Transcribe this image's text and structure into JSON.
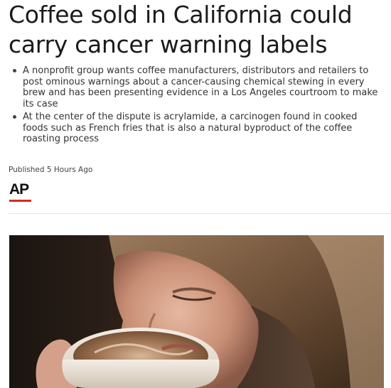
{
  "article": {
    "headline": "Coffee sold in California could carry cancer warning labels",
    "bullets": [
      "A nonprofit group wants coffee manufacturers, distributors and retailers to post ominous warnings about a cancer-causing chemical stewing in every brew and has been presenting evidence in a Los Angeles courtroom to make its case",
      "At the center of the dispute is acrylamide, a carcinogen found in cooked foods such as French fries that is also a natural byproduct of the coffee roasting process"
    ],
    "published": "Published 5 Hours Ago",
    "source_logo_text": "AP",
    "source_logo_color": "#d52b1e"
  },
  "photo": {
    "icon": "woman-drinking-coffee-photo"
  }
}
